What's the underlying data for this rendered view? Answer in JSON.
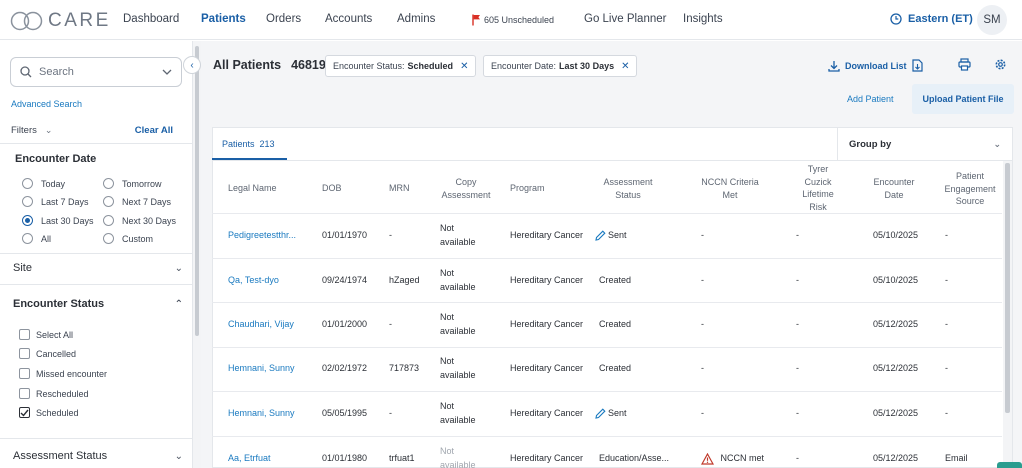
{
  "app": {
    "logo_text": "CARE"
  },
  "nav": {
    "items": [
      "Dashboard",
      "Patients",
      "Orders",
      "Accounts",
      "Admins"
    ],
    "unscheduled": "605 Unscheduled",
    "go_live": "Go Live Planner",
    "insights": "Insights",
    "timezone": "Eastern (ET)",
    "user_initials": "SM"
  },
  "sidebar": {
    "search_placeholder": "Search",
    "advanced_search": "Advanced Search",
    "filters_label": "Filters",
    "clear_all": "Clear All",
    "encounter_date": {
      "title": "Encounter Date",
      "options": [
        "Today",
        "Tomorrow",
        "Last 7 Days",
        "Next 7 Days",
        "Last 30 Days",
        "Next 30 Days",
        "All",
        "Custom"
      ],
      "selected": "Last 30 Days"
    },
    "site_label": "Site",
    "encounter_status": {
      "title": "Encounter Status",
      "options": [
        "Select All",
        "Cancelled",
        "Missed encounter",
        "Rescheduled",
        "Scheduled"
      ],
      "checked": "Scheduled"
    },
    "assessment_status_label": "Assessment Status"
  },
  "main": {
    "title": "All Patients",
    "total": "46819",
    "chips": [
      {
        "label": "Encounter Status:",
        "value": "Scheduled"
      },
      {
        "label": "Encounter Date:",
        "value": "Last 30 Days"
      }
    ],
    "download_list": "Download List",
    "add_patient": "Add Patient",
    "upload_file": "Upload Patient File",
    "tab_label": "Patients",
    "tab_count": "213",
    "group_by": "Group by"
  },
  "table": {
    "headers": {
      "name": "Legal Name",
      "dob": "DOB",
      "mrn": "MRN",
      "copy_1": "Copy",
      "copy_2": "Assessment",
      "program": "Program",
      "assess_1": "Assessment",
      "assess_2": "Status",
      "nccn_1": "NCCN Criteria",
      "nccn_2": "Met",
      "tyrer_1": "Tyrer",
      "tyrer_2": "Cuzick",
      "tyrer_3": "Lifetime",
      "tyrer_4": "Risk",
      "enc_1": "Encounter",
      "enc_2": "Date",
      "eng_1": "Patient",
      "eng_2": "Engagement",
      "eng_3": "Source"
    },
    "rows": [
      {
        "name": "Pedigreetestthr...",
        "dob": "01/01/1970",
        "mrn": "-",
        "copy_1": "Not",
        "copy_2": "available",
        "program": "Hereditary Cancer",
        "status": "Sent",
        "nccn": "-",
        "tyrer": "-",
        "date": "05/10/2025",
        "source": "-"
      },
      {
        "name": "Qa, Test-dyo",
        "dob": "09/24/1974",
        "mrn": "hZaged",
        "copy_1": "Not",
        "copy_2": "available",
        "program": "Hereditary Cancer",
        "status": "Created",
        "nccn": "-",
        "tyrer": "-",
        "date": "05/10/2025",
        "source": "-"
      },
      {
        "name": "Chaudhari, Vijay",
        "dob": "01/01/2000",
        "mrn": "-",
        "copy_1": "Not",
        "copy_2": "available",
        "program": "Hereditary Cancer",
        "status": "Created",
        "nccn": "-",
        "tyrer": "-",
        "date": "05/12/2025",
        "source": "-"
      },
      {
        "name": "Hemnani, Sunny",
        "dob": "02/02/1972",
        "mrn": "717873",
        "copy_1": "Not",
        "copy_2": "available",
        "program": "Hereditary Cancer",
        "status": "Created",
        "nccn": "-",
        "tyrer": "-",
        "date": "05/12/2025",
        "source": "-"
      },
      {
        "name": "Hemnani, Sunny",
        "dob": "05/05/1995",
        "mrn": "-",
        "copy_1": "Not",
        "copy_2": "available",
        "program": "Hereditary Cancer",
        "status": "Sent",
        "nccn": "-",
        "tyrer": "-",
        "date": "05/12/2025",
        "source": "-"
      },
      {
        "name": "Aa, Etrfuat",
        "dob": "01/01/1980",
        "mrn": "trfuat1",
        "copy_1": "Not",
        "copy_2": "available",
        "program": "Hereditary Cancer",
        "status": "Education/Asse...",
        "nccn": "NCCN met",
        "tyrer": "-",
        "date": "05/12/2025",
        "source": "Email"
      }
    ]
  },
  "colors": {
    "accent": "#1a5fa6",
    "link": "#1a7ac0",
    "flag": "#d93025",
    "warning": "#c0392b"
  }
}
